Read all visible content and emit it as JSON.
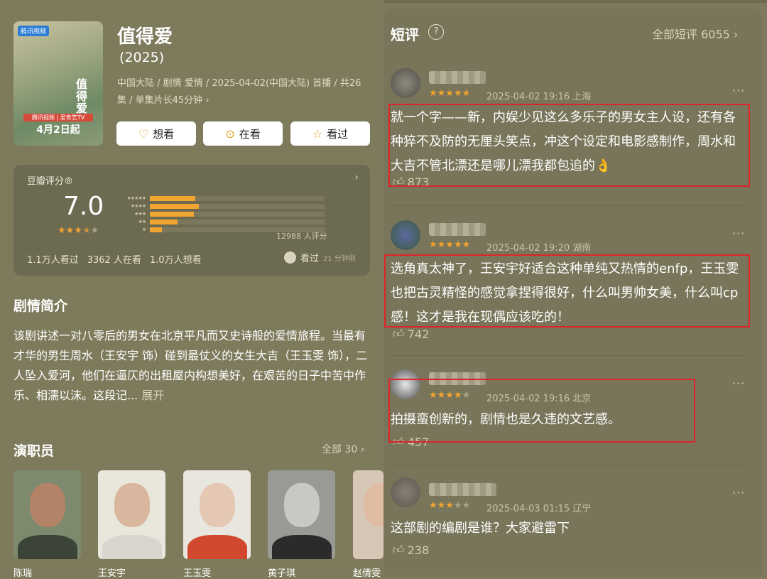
{
  "movie": {
    "title": "值得爱",
    "year": "(2025)",
    "meta": "中国大陆 / 剧情 爱情 / 2025-04-02(中国大陆) 首播 / 共26集 / 单集片长45分钟 ›",
    "poster": {
      "badge": "腾讯视频",
      "title_art": "值得爱",
      "date": "4月2日起",
      "sub": "腾讯视频 | 爱奇艺TV"
    }
  },
  "actions": [
    {
      "label": "想看",
      "icon": "heart-plus-icon"
    },
    {
      "label": "在看",
      "icon": "eye-icon"
    },
    {
      "label": "看过",
      "icon": "star-icon"
    }
  ],
  "rating": {
    "label": "豆瓣评分®",
    "score": "7.0",
    "stars": 3.5,
    "distribution": [
      {
        "stars": "★★★★★",
        "fraction": 0.26
      },
      {
        "stars": "★★★★",
        "fraction": 0.28
      },
      {
        "stars": "★★★",
        "fraction": 0.25
      },
      {
        "stars": "★★",
        "fraction": 0.16
      },
      {
        "stars": "★",
        "fraction": 0.07
      }
    ],
    "count": "12988 人评分",
    "watched": "1.1万人看过",
    "watching": "3362 人在看",
    "wish": "1.0万人想看",
    "friend_status": "看过",
    "friend_time": "21 分钟前"
  },
  "summary": {
    "heading": "剧情简介",
    "text": "该剧讲述一对八零后的男女在北京平凡而又史诗般的爱情旅程。当最有才华的男生周水（王安宇 饰）碰到最仗义的女生大吉（王玉雯 饰），二人坠入爱河，他们在逼仄的出租屋内构想美好，在艰苦的日子中苦中作乐、相濡以沫。这段记...",
    "more": "展开"
  },
  "cast": {
    "heading": "演职员",
    "all": "全部 30 ›",
    "members": [
      {
        "name": "陈瑞"
      },
      {
        "name": "王安宇"
      },
      {
        "name": "王玉雯"
      },
      {
        "name": "黄子琪"
      },
      {
        "name": "赵倩雯"
      }
    ]
  },
  "short_reviews": {
    "heading": "短评",
    "help": "?",
    "all": "全部短评 6055 ›",
    "items": [
      {
        "stars": 5,
        "meta": "2025-04-02 19:16 上海",
        "text": "就一个字——新，内娱少见这么多乐子的男女主人设，还有各种猝不及防的无厘头笑点，冲这个设定和电影感制作，周水和大吉不管北漂还是哪儿漂我都包追的👌",
        "likes": "873"
      },
      {
        "stars": 5,
        "meta": "2025-04-02 19:20 湖南",
        "text": "选角真太神了，王安宇好适合这种单纯又热情的enfp，王玉雯也把古灵精怪的感觉拿捏得很好，什么叫男帅女美，什么叫cp感！这才是我在现偶应该吃的！",
        "likes": "742"
      },
      {
        "stars": 4,
        "meta": "2025-04-02 19:16 北京",
        "text": "拍摄蛮创新的，剧情也是久违的文艺感。",
        "likes": "457"
      },
      {
        "stars": 3,
        "meta": "2025-04-03 01:15 辽宁",
        "text": "这部剧的编剧是谁？大家避雷下",
        "likes": "238"
      }
    ]
  },
  "colors": {
    "accent_star": "#f2a531",
    "highlight_box": "#e0232a"
  }
}
